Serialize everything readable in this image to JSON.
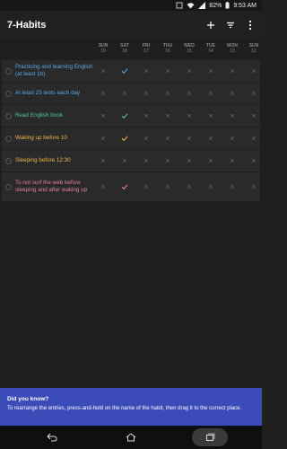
{
  "status": {
    "battery": "82%",
    "time": "9:53 AM"
  },
  "app_bar": {
    "title": "7-Habits"
  },
  "days": [
    {
      "name": "SUN",
      "num": "19"
    },
    {
      "name": "SAT",
      "num": "18"
    },
    {
      "name": "FRI",
      "num": "17"
    },
    {
      "name": "THU",
      "num": "16"
    },
    {
      "name": "WED",
      "num": "15"
    },
    {
      "name": "TUE",
      "num": "14"
    },
    {
      "name": "MON",
      "num": "13"
    },
    {
      "name": "SUN",
      "num": "12"
    }
  ],
  "habits": [
    {
      "name": "Practicing and learning English (at least 1h)",
      "color": "#5aa9e6",
      "marks": [
        "x",
        "check",
        "x",
        "x",
        "x",
        "x",
        "x",
        "x"
      ]
    },
    {
      "name": "At least 25 tests each day",
      "color": "#5aa9e6",
      "marks": [
        "x",
        "x",
        "x",
        "x",
        "x",
        "x",
        "x",
        "x"
      ]
    },
    {
      "name": "Read English book",
      "color": "#4ec9a8",
      "marks": [
        "x",
        "check",
        "x",
        "x",
        "x",
        "x",
        "x",
        "x"
      ]
    },
    {
      "name": "Waking up before 10",
      "color": "#f0b84a",
      "marks": [
        "x",
        "check",
        "x",
        "x",
        "x",
        "x",
        "x",
        "x"
      ]
    },
    {
      "name": "Sleeping before 12:30",
      "color": "#f0b84a",
      "marks": [
        "x",
        "x",
        "x",
        "x",
        "x",
        "x",
        "x",
        "x"
      ]
    },
    {
      "name": "To not surf the web before sleeping and after waking up",
      "color": "#e57fa0",
      "marks": [
        "x",
        "check",
        "x",
        "x",
        "x",
        "x",
        "x",
        "x"
      ]
    }
  ],
  "tip": {
    "title": "Did you know?",
    "text": "To rearrange the entries, press-and-hold on the name of the habit, then drag it to the correct place."
  },
  "icons": {
    "wifi": "wifi-icon",
    "battery": "battery-icon",
    "add": "plus-icon",
    "filter": "filter-icon",
    "more": "more-vert-icon",
    "back": "back-icon",
    "home": "home-icon",
    "recents": "recents-icon"
  }
}
